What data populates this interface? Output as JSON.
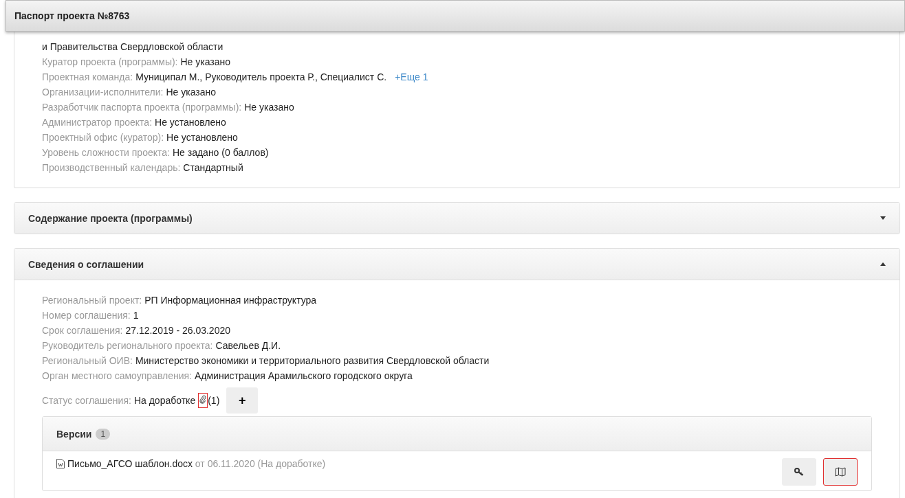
{
  "window": {
    "title": "Паспорт проекта №8763"
  },
  "passport_panel": {
    "continuation": "и Правительства Свердловской области",
    "fields": [
      {
        "label": "Куратор проекта (программы):",
        "value": "Не указано"
      },
      {
        "label": "Проектная команда:",
        "value": "Муниципал М., Руководитель проекта Р., Специалист С.",
        "link": "+Еще 1"
      },
      {
        "label": "Организации-исполнители:",
        "value": "Не указано"
      },
      {
        "label": "Разработчик паспорта проекта (программы):",
        "value": "Не указано"
      },
      {
        "label": "Администратор проекта:",
        "value": "Не установлено"
      },
      {
        "label": "Проектный офис (куратор):",
        "value": "Не установлено"
      },
      {
        "label": "Уровень сложности проекта:",
        "value": "Не задано (0 баллов)"
      },
      {
        "label": "Производственный календарь:",
        "value": "Стандартный"
      }
    ]
  },
  "sections": [
    {
      "title": "Содержание проекта (программы)",
      "expanded": false
    },
    {
      "title": "Сведения о соглашении",
      "expanded": true,
      "fields": [
        {
          "label": "Региональный проект:",
          "value": "РП Информационная инфраструктура"
        },
        {
          "label": "Номер соглашения:",
          "value": "1"
        },
        {
          "label": "Срок соглашения:",
          "value": "27.12.2019 - 26.03.2020"
        },
        {
          "label": "Руководитель регионального проекта:",
          "value": "Савельев Д.И."
        },
        {
          "label": "Региональный ОИВ:",
          "value": "Министерство экономики и территориального развития Свердловской области"
        },
        {
          "label": "Орган местного самоуправления:",
          "value": "Администрация Арамильского городского округа"
        }
      ],
      "status": {
        "label": "Статус соглашения:",
        "value": "На доработке",
        "attachments": "(1)",
        "attachment_highlighted": true,
        "add_button": "+"
      },
      "versions": {
        "title": "Версии",
        "count": "1",
        "items": [
          {
            "file": "Письмо_АГСО шаблон.docx",
            "date": "от 06.11.2020",
            "state": "(На доработке)",
            "map_highlighted": true
          }
        ]
      }
    }
  ]
}
